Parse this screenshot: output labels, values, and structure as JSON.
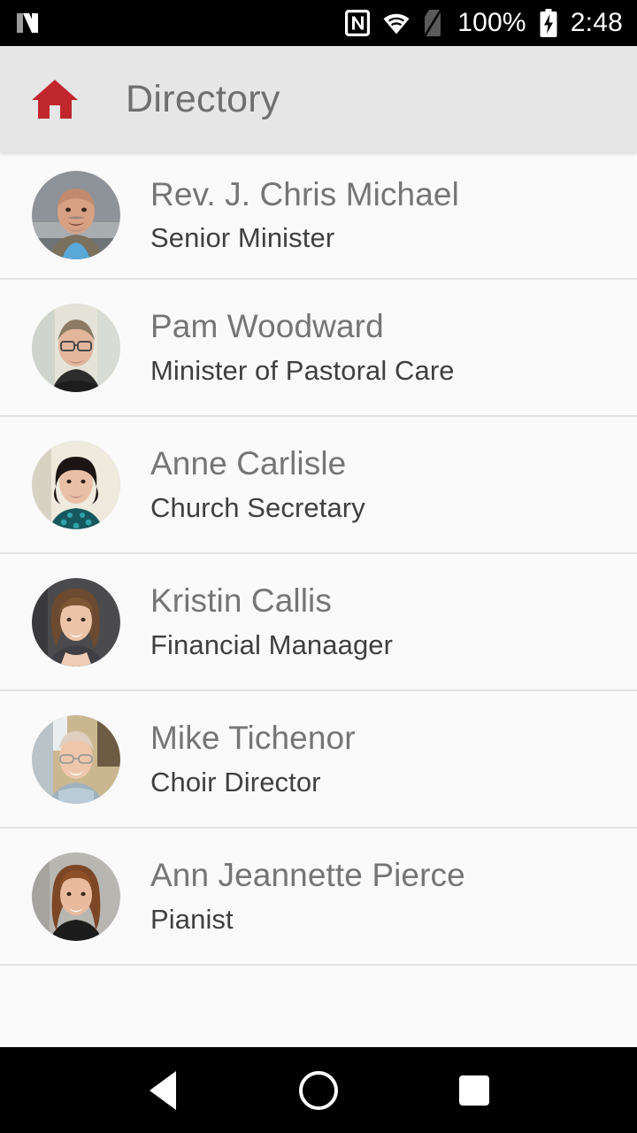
{
  "status_bar": {
    "left_icon": "android-nougat-n-icon",
    "icons": [
      "nfc-icon",
      "wifi-icon",
      "no-sim-icon"
    ],
    "battery_percent": "100%",
    "battery_icon": "battery-charging-icon",
    "time": "2:48"
  },
  "app_bar": {
    "home_icon": "home-icon",
    "home_icon_color": "#c0272d",
    "title": "Directory",
    "title_color": "#6f6f6f",
    "background_color": "#e6e6e6"
  },
  "directory": {
    "background_color": "#fafafa",
    "divider_color": "#e3e3e3",
    "name_color": "#757575",
    "role_color": "#3f3f3f",
    "people": [
      {
        "name": "Rev. J. Chris Michael",
        "role": "Senior Minister",
        "avatar": "photo-rev-j-chris-michael"
      },
      {
        "name": "Pam Woodward",
        "role": "Minister of Pastoral Care",
        "avatar": "photo-pam-woodward"
      },
      {
        "name": "Anne Carlisle",
        "role": "Church Secretary",
        "avatar": "photo-anne-carlisle"
      },
      {
        "name": "Kristin Callis",
        "role": "Financial Manaager",
        "avatar": "photo-kristin-callis"
      },
      {
        "name": "Mike Tichenor",
        "role": "Choir Director",
        "avatar": "photo-mike-tichenor"
      },
      {
        "name": "Ann Jeannette Pierce",
        "role": "Pianist",
        "avatar": "photo-ann-jeannette-pierce"
      }
    ]
  },
  "nav_bar": {
    "background_color": "#000000",
    "back_icon": "back-triangle-icon",
    "home_icon": "home-circle-icon",
    "recents_icon": "recents-square-icon"
  }
}
